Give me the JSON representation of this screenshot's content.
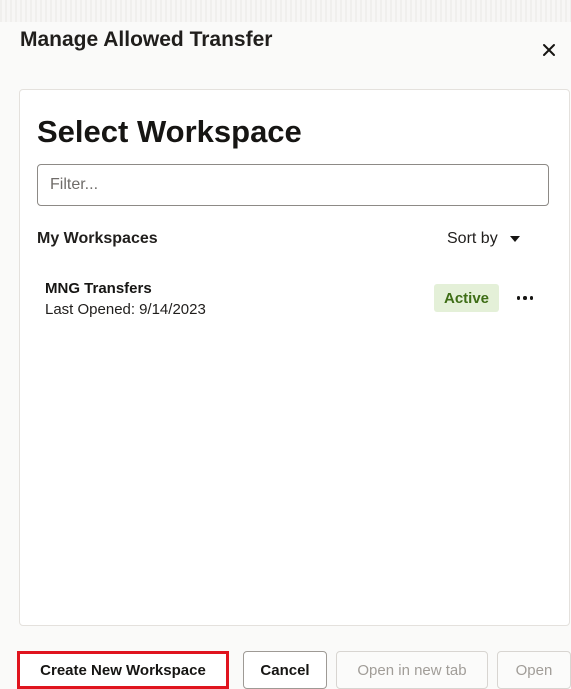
{
  "dialog": {
    "title": "Manage Allowed Transfer",
    "close_icon": "close-icon"
  },
  "panel": {
    "title": "Select Workspace",
    "filter": {
      "placeholder": "Filter...",
      "value": ""
    },
    "section_label": "My Workspaces",
    "sort_label": "Sort by",
    "workspaces": [
      {
        "name": "MNG Transfers",
        "last_opened_label": "Last Opened:",
        "last_opened_value": "9/14/2023",
        "status": "Active"
      }
    ]
  },
  "footer": {
    "create_label": "Create New Workspace",
    "cancel_label": "Cancel",
    "open_new_tab_label": "Open in new tab",
    "open_label": "Open"
  },
  "colors": {
    "highlight_border": "#e0141e",
    "status_bg": "#e4f0d8",
    "status_text": "#3e6d16"
  }
}
